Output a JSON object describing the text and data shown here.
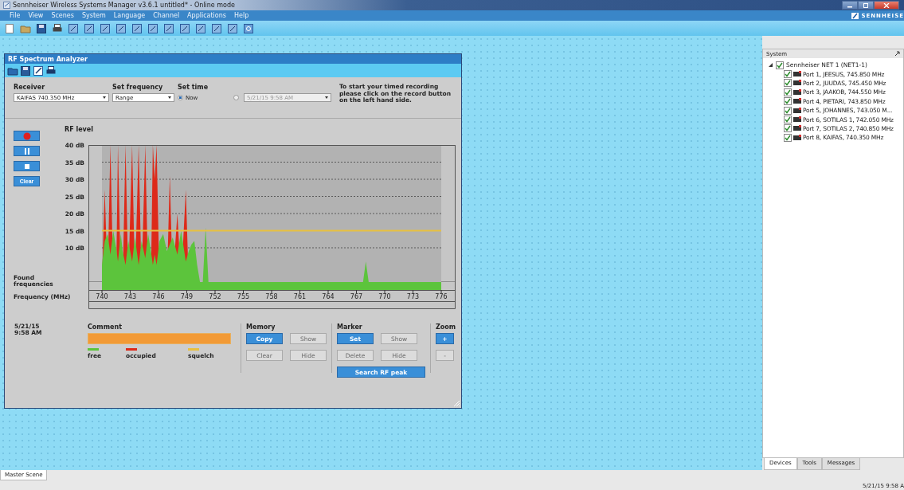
{
  "window": {
    "title": "Sennheiser Wireless Systems Manager v3.6.1 untitled* - Online mode",
    "brand": "SENNHEISE"
  },
  "menu": [
    "File",
    "View",
    "Scenes",
    "System",
    "Language",
    "Channel",
    "Applications",
    "Help"
  ],
  "analyzer": {
    "title": "RF Spectrum Analyzer",
    "receiver": {
      "label": "Receiver",
      "value": "KAIFAS 740.350 MHz"
    },
    "set_frequency": {
      "label": "Set frequency",
      "value": "Range"
    },
    "set_time": {
      "label": "Set time",
      "options": [
        {
          "label": "Now",
          "selected": true
        },
        {
          "value": "5/21/15 9:58 AM",
          "selected": false
        }
      ]
    },
    "hint": "To start your timed recording please click on the record button on the left hand side.",
    "clear_button": "Clear",
    "found_label": "Found frequencies",
    "timestamp": [
      "5/21/15",
      "9:58 AM"
    ],
    "comment": {
      "label": "Comment"
    },
    "memory": {
      "label": "Memory",
      "buttons": [
        {
          "label": "Copy",
          "disabled": false
        },
        {
          "label": "Show",
          "disabled": true
        },
        {
          "label": "Clear",
          "disabled": true
        },
        {
          "label": "Hide",
          "disabled": true
        }
      ]
    },
    "marker": {
      "label": "Marker",
      "buttons": [
        {
          "label": "Set",
          "disabled": false
        },
        {
          "label": "Show",
          "disabled": true
        },
        {
          "label": "Delete",
          "disabled": true
        },
        {
          "label": "Hide",
          "disabled": true
        }
      ],
      "search": "Search RF peak"
    },
    "zoom": {
      "label": "Zoom",
      "buttons": [
        {
          "label": "+",
          "disabled": false
        },
        {
          "label": "-",
          "disabled": true
        }
      ]
    },
    "chart_data": {
      "type": "area",
      "ylabel": "RF level",
      "xlabel": "Frequency (MHz)",
      "xlim": [
        740,
        776
      ],
      "ylim": [
        0,
        40
      ],
      "xticks": [
        740,
        743,
        746,
        749,
        752,
        755,
        758,
        761,
        764,
        767,
        770,
        773,
        776
      ],
      "yticks": [
        {
          "value": 10,
          "label": "10 dB"
        },
        {
          "value": 15,
          "label": "15 dB"
        },
        {
          "value": 20,
          "label": "20 dB"
        },
        {
          "value": 25,
          "label": "25 dB"
        },
        {
          "value": 30,
          "label": "30 dB"
        },
        {
          "value": 35,
          "label": "35 dB"
        },
        {
          "value": 40,
          "label": "40 dB"
        }
      ],
      "x": [
        740,
        740.3,
        740.6,
        740.9,
        741.2,
        741.5,
        741.7,
        742,
        742.2,
        742.5,
        742.8,
        743.2,
        743.5,
        743.9,
        744.2,
        744.6,
        744.9,
        745.2,
        745.4,
        745.6,
        745.8,
        746.1,
        746.5,
        746.9,
        747.2,
        747.5,
        748,
        748.4,
        748.9,
        749.2,
        749.5,
        749.8,
        750.1,
        750.4,
        750.7,
        751,
        751.3,
        752,
        767.7,
        768,
        768.3,
        776
      ],
      "series": [
        {
          "name": "free",
          "color": "#5cc43c",
          "values": [
            5,
            12,
            14,
            8,
            15,
            10,
            6,
            14,
            9,
            5,
            12,
            6,
            13,
            5,
            12,
            7,
            14,
            9,
            5,
            8,
            5,
            12,
            14,
            9,
            11,
            13,
            8,
            15,
            6,
            9,
            11,
            12,
            5,
            0,
            0,
            16,
            0,
            0,
            0,
            6,
            0,
            0
          ]
        },
        {
          "name": "occupied",
          "color": "#dd2a1a",
          "values": [
            0,
            27,
            0,
            40,
            0,
            0,
            40,
            0,
            0,
            40,
            0,
            40,
            0,
            40,
            0,
            40,
            0,
            0,
            40,
            30,
            40,
            0,
            0,
            0,
            31,
            0,
            20,
            0,
            27,
            0,
            0,
            0,
            0,
            0,
            0,
            0,
            0,
            0,
            0,
            0,
            0,
            0
          ]
        },
        {
          "name": "squelch",
          "color": "#e8c040",
          "type": "line",
          "values": [
            15,
            15,
            15,
            15,
            15,
            15,
            15,
            15,
            15,
            15,
            15,
            15,
            15,
            15,
            15,
            15,
            15,
            15,
            15,
            15,
            15,
            15,
            15,
            15,
            15,
            15,
            15,
            15,
            15,
            15,
            15,
            15,
            15,
            15,
            15,
            15,
            15,
            15,
            15,
            15,
            15,
            15
          ]
        }
      ],
      "grid": true
    }
  },
  "system_panel": {
    "title": "System",
    "tree": [
      {
        "label": "Sennheiser NET 1 (NET1-1)",
        "checked": true,
        "expanded": true,
        "children": [
          {
            "label": "Port 1, JEESUS, 745.850 MHz",
            "checked": true
          },
          {
            "label": "Port 2, JUUDAS, 745.450 MHz",
            "checked": true
          },
          {
            "label": "Port 3, JAAKOB, 744.550 MHz",
            "checked": true
          },
          {
            "label": "Port 4, PIETARI, 743.850 MHz",
            "checked": true
          },
          {
            "label": "Port 5, JOHANNES, 743.050 M...",
            "checked": true
          },
          {
            "label": "Port 6, SOTILAS 1, 742.050 MHz",
            "checked": true
          },
          {
            "label": "Port 7, SOTILAS 2, 740.850 MHz",
            "checked": true
          },
          {
            "label": "Port 8, KAIFAS, 740.350 MHz",
            "checked": true
          }
        ]
      }
    ]
  },
  "panel_tabs": [
    {
      "label": "Devices",
      "selected": true
    },
    {
      "label": "Tools",
      "selected": false
    },
    {
      "label": "Messages",
      "selected": false
    }
  ],
  "scene_tabs": [
    {
      "label": "Master Scene",
      "selected": true
    }
  ],
  "status": "5/21/15  9:58 A"
}
